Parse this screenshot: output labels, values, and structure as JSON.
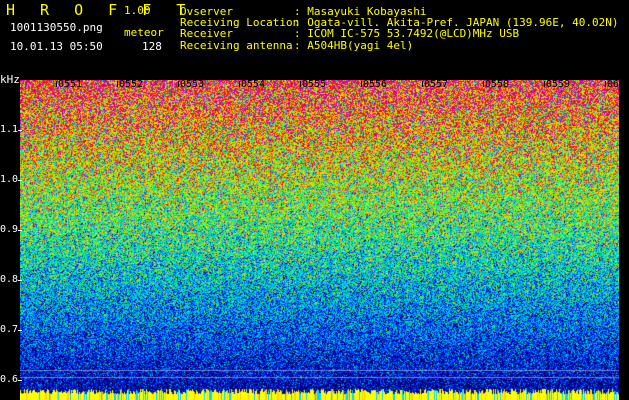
{
  "header": {
    "title": "H R O F F T",
    "version": "1.00",
    "filename": "1001130550.png",
    "datetime": "10.01.13 05:50",
    "mode": "meteor",
    "count": "128"
  },
  "info": {
    "observer_label": "Ovserver",
    "observer_value": ": Masayuki Kobayashi",
    "location_label": "Receiving Location",
    "location_value": ": Ogata-vill. Akita-Pref. JAPAN (139.96E, 40.02N)",
    "receiver_label": "Receiver",
    "receiver_value": ": ICOM IC-575 53.7492(@LCD)MHz USB",
    "antenna_label": "Receiving antenna",
    "antenna_value": ": A504HB(yagi 4el)"
  },
  "axis": {
    "y_unit": "kHz",
    "y_ticks": [
      "1.1",
      "1.0",
      "0.9",
      "0.8",
      "0.7",
      "0.6"
    ],
    "x_ticks": [
      "0551",
      "0552",
      "0553",
      "0554",
      "0555",
      "0556",
      "0557",
      "0558",
      "0559",
      "0600"
    ]
  },
  "colors": {
    "background": "#000000",
    "header_text": "#ffff00",
    "info_text": "#ffffff",
    "bottom_band": "#ffff00"
  }
}
